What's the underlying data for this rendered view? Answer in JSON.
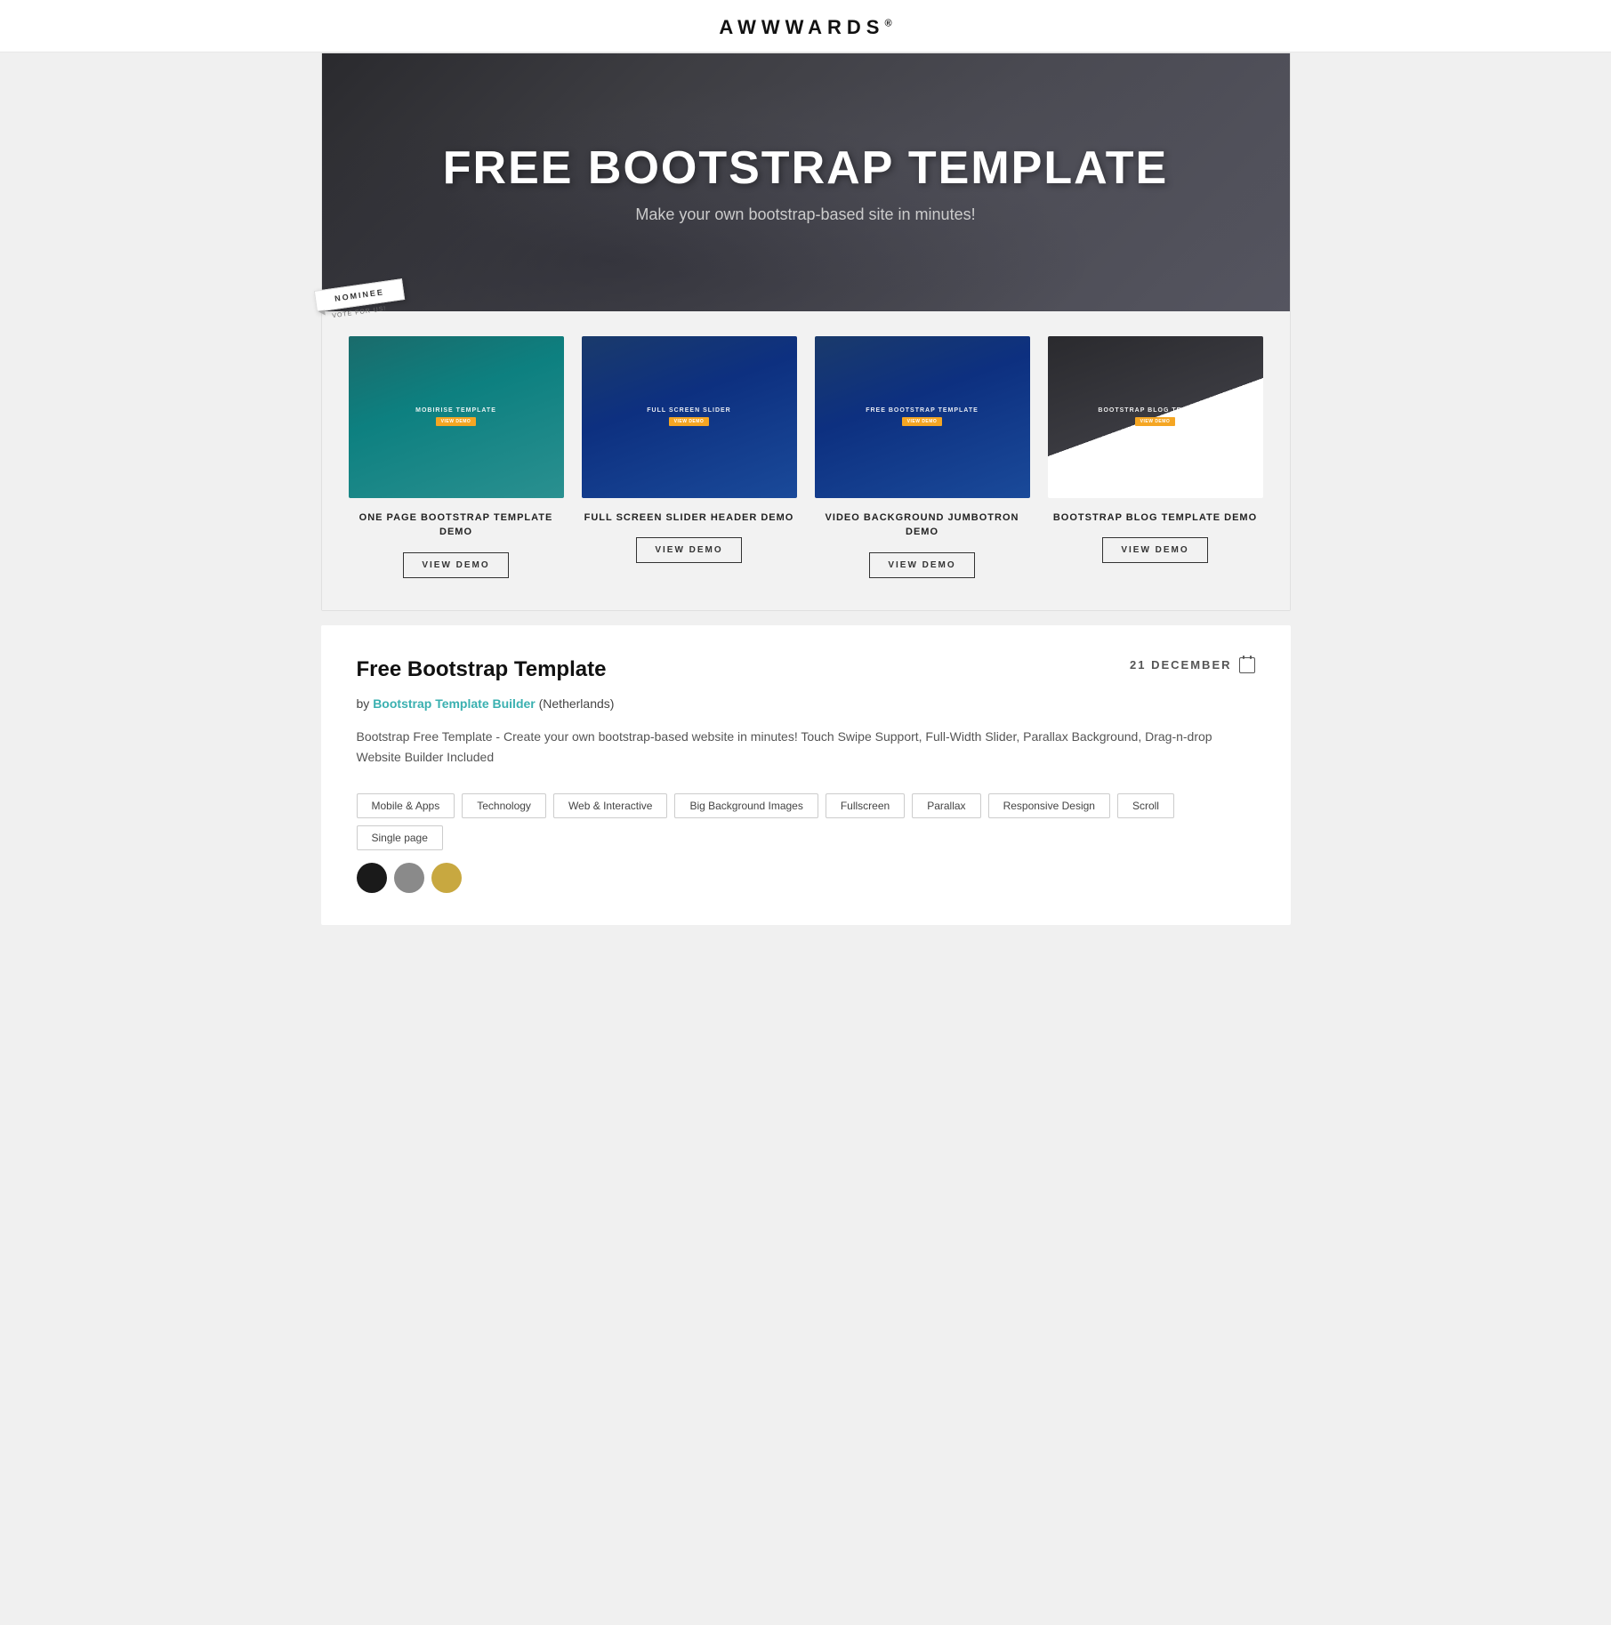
{
  "header": {
    "logo": "AWWWARDS",
    "logo_suffix": "®"
  },
  "hero": {
    "title": "FREE BOOTSTRAP TEMPLATE",
    "subtitle": "Make your own bootstrap-based site in minutes!",
    "nominee_text": "NOMINEE",
    "vote_text": "VOTE FOR US!"
  },
  "demos": [
    {
      "id": "demo-1",
      "thumbnail_class": "thumb-1",
      "thumb_label": "MOBIRISE TEMPLATE",
      "name": "ONE PAGE BOOTSTRAP TEMPLATE DEMO",
      "btn_label": "VIEW DEMO"
    },
    {
      "id": "demo-2",
      "thumbnail_class": "thumb-2",
      "thumb_label": "FULL SCREEN SLIDER",
      "name": "FULL SCREEN SLIDER HEADER DEMO",
      "btn_label": "VIEW DEMO"
    },
    {
      "id": "demo-3",
      "thumbnail_class": "thumb-3",
      "thumb_label": "FREE BOOTSTRAP TEMPLATE",
      "name": "VIDEO BACKGROUND JUMBOTRON DEMO",
      "btn_label": "VIEW DEMO"
    },
    {
      "id": "demo-4",
      "thumbnail_class": "thumb-4",
      "thumb_label": "BOOTSTRAP BLOG TEMPLATE",
      "name": "BOOTSTRAP BLOG TEMPLATE DEMO",
      "btn_label": "VIEW DEMO"
    }
  ],
  "info": {
    "title": "Free Bootstrap Template",
    "date": "21 DECEMBER",
    "author_prefix": "by",
    "author_name": "Bootstrap Template Builder",
    "author_suffix": "(Netherlands)",
    "description": "Bootstrap Free Template - Create your own bootstrap-based website in minutes! Touch Swipe Support, Full-Width Slider, Parallax Background, Drag-n-drop Website Builder Included",
    "tags": [
      "Mobile & Apps",
      "Technology",
      "Web & Interactive",
      "Big Background Images",
      "Fullscreen",
      "Parallax",
      "Responsive Design",
      "Scroll",
      "Single page"
    ],
    "colors": [
      {
        "name": "black",
        "hex": "#1a1a1a"
      },
      {
        "name": "gray",
        "hex": "#8a8a8a"
      },
      {
        "name": "gold",
        "hex": "#c8a840"
      }
    ]
  }
}
